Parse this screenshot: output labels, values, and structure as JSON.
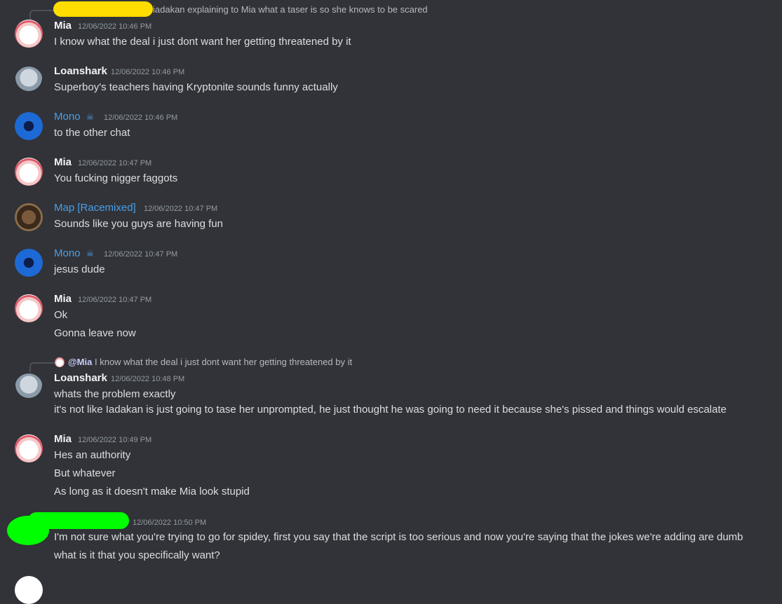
{
  "messages": [
    {
      "reply_preview": "iadakan explaining to Mia what a taser is so she knows to be scared",
      "author": "Mia",
      "timestamp": "12/06/2022 10:46 PM",
      "lines": [
        "I know what the deal i just dont want her getting threatened by it"
      ]
    },
    {
      "author": "Loanshark",
      "timestamp": "12/06/2022 10:46 PM",
      "lines": [
        "Superboy's teachers having Kryptonite sounds funny actually"
      ]
    },
    {
      "author": "Mono",
      "badge_icon": "skull-crossbones-icon",
      "timestamp": "12/06/2022 10:46 PM",
      "lines": [
        "to the other chat"
      ]
    },
    {
      "author": "Mia",
      "timestamp": "12/06/2022 10:47 PM",
      "lines": [
        "You fucking nigger faggots"
      ]
    },
    {
      "author": "Map [Racemixed]",
      "timestamp": "12/06/2022 10:47 PM",
      "lines": [
        "Sounds like you guys are having fun"
      ]
    },
    {
      "author": "Mono",
      "badge_icon": "skull-crossbones-icon",
      "timestamp": "12/06/2022 10:47 PM",
      "lines": [
        "jesus dude"
      ]
    },
    {
      "author": "Mia",
      "timestamp": "12/06/2022 10:47 PM",
      "lines": [
        "Ok",
        "Gonna leave now"
      ]
    },
    {
      "reply_mention": "@Mia",
      "reply_preview": "I know what the deal i just dont want her getting threatened by it",
      "author": "Loanshark",
      "timestamp": "12/06/2022 10:48 PM",
      "lines": [
        "whats the problem exactly",
        "it's not like Iadakan is just going to tase her unprompted, he just thought he was going to need it because she's pissed and things would escalate"
      ]
    },
    {
      "author": "Mia",
      "timestamp": "12/06/2022 10:49 PM",
      "lines": [
        "Hes an authority",
        "But whatever",
        "As long as it doesn't make Mia look stupid"
      ]
    },
    {
      "author_redacted": true,
      "timestamp": "12/06/2022 10:50 PM",
      "lines": [
        "I'm not sure what you're trying to go for spidey, first you say that the script is too serious and now you're saying that the jokes we're adding are dumb",
        "what is it that you specifically want?"
      ]
    }
  ],
  "colors": {
    "background": "#313338",
    "role_blue": "#4a9ee8",
    "redaction_yellow": "#ffdd00",
    "redaction_green": "#00ff00"
  }
}
